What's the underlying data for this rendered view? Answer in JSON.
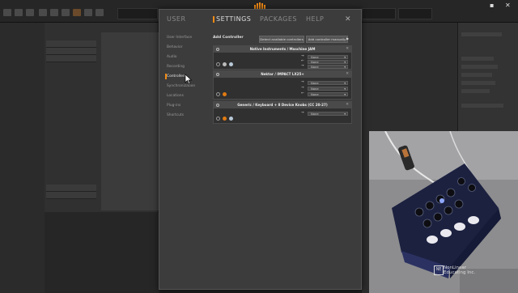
{
  "dialog": {
    "tabs": [
      "USER",
      "SETTINGS",
      "PACKAGES",
      "HELP"
    ],
    "active_tab": "SETTINGS",
    "close_glyph": "✕"
  },
  "nav": {
    "items": [
      "User Interface",
      "Behavior",
      "Audio",
      "Recording",
      "Controllers",
      "Synchronization",
      "Locations",
      "Plug-ins",
      "Shortcuts"
    ],
    "active": "Controllers"
  },
  "controllers": {
    "title": "Add Controller",
    "detect_button": "Detect available controllers",
    "add_manually_button": "Add controller manually",
    "add_manually_arrow": "▶",
    "list": [
      {
        "name": "Native Instruments / Maschine JAM",
        "ports": [
          {
            "dir": "in",
            "value": "None"
          },
          {
            "dir": "out",
            "value": "None"
          },
          {
            "dir": "in",
            "value": "None"
          }
        ]
      },
      {
        "name": "Nektar / IMPACT LX25+",
        "ports": [
          {
            "dir": "in",
            "value": "None"
          },
          {
            "dir": "in",
            "value": "None"
          },
          {
            "dir": "out",
            "value": "None"
          }
        ]
      },
      {
        "name": "Generic / Keyboard + 8 Device Knobs (CC 20-27)",
        "ports": [
          {
            "dir": "in",
            "value": "None"
          }
        ]
      }
    ]
  },
  "watermark": {
    "logo": "NE",
    "line1": "NonLinear",
    "line2": "Educating Inc."
  },
  "icons": {
    "in": "→",
    "out": "←",
    "dropdown": "▾",
    "close": "✕"
  },
  "colors": {
    "accent": "#f08a16",
    "dialog_bg": "#3c3c3c",
    "app_bg": "#1e1e1e"
  }
}
